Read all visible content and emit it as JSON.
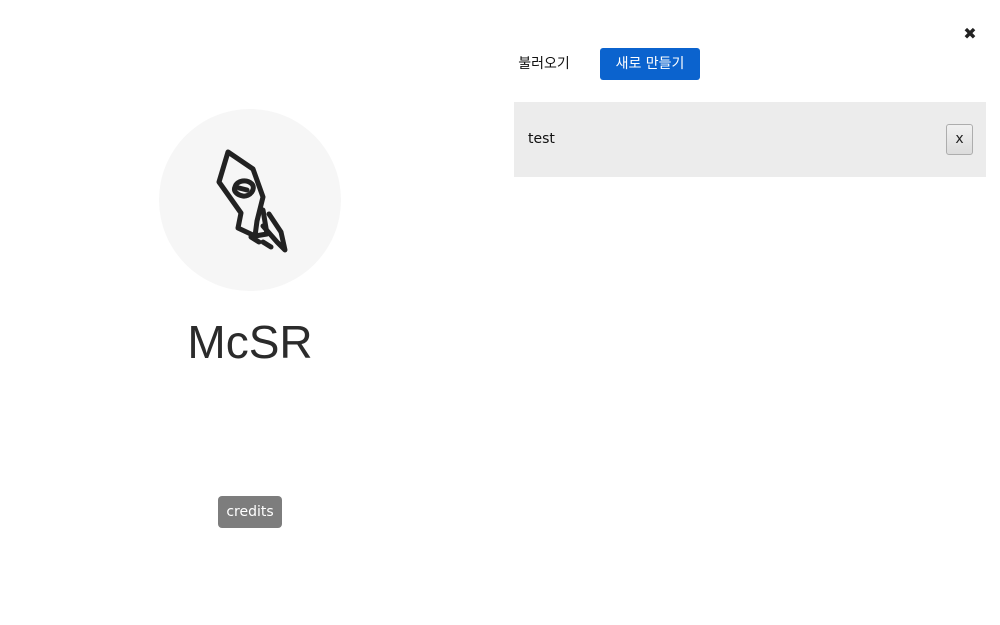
{
  "app": {
    "title": "McSR",
    "logo_icon": "rocket-icon",
    "credits_label": "credits"
  },
  "header": {
    "load_label": "불러오기",
    "new_label": "새로 만들기",
    "close_glyph": "✖"
  },
  "projects": [
    {
      "name": "test",
      "delete_label": "x"
    }
  ],
  "colors": {
    "accent": "#0b63ce",
    "credits_bg": "#7d7d7d",
    "list_item_bg": "#ececec",
    "logo_bg": "#f6f6f6"
  }
}
